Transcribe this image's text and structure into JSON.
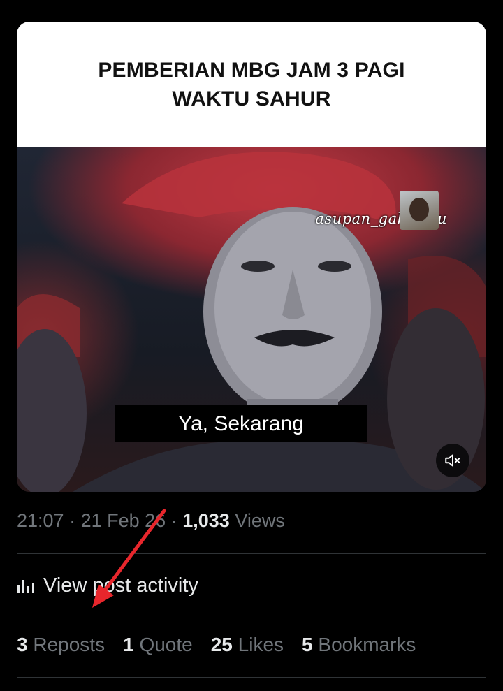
{
  "media": {
    "caption_line1": "PEMBERIAN MBG JAM 3 PAGI",
    "caption_line2": "WAKTU SAHUR",
    "watermark": "asupan_gabutmu",
    "subtitle": "Ya, Sekarang",
    "mute_icon": "speaker-muted-icon"
  },
  "meta": {
    "time": "21:07",
    "sep1": "·",
    "date": "21 Feb 26",
    "sep2": "·",
    "views_count": "1,033",
    "views_label": "Views"
  },
  "activity": {
    "icon": "bar-chart-icon",
    "label": "View post activity"
  },
  "stats": [
    {
      "count": "3",
      "label": "Reposts"
    },
    {
      "count": "1",
      "label": "Quote"
    },
    {
      "count": "25",
      "label": "Likes"
    },
    {
      "count": "5",
      "label": "Bookmarks"
    }
  ],
  "colors": {
    "background": "#000000",
    "primary_text": "#e7e9ea",
    "secondary_text": "#71767b",
    "divider": "#2f3336",
    "annotation_arrow": "#e8262c"
  }
}
